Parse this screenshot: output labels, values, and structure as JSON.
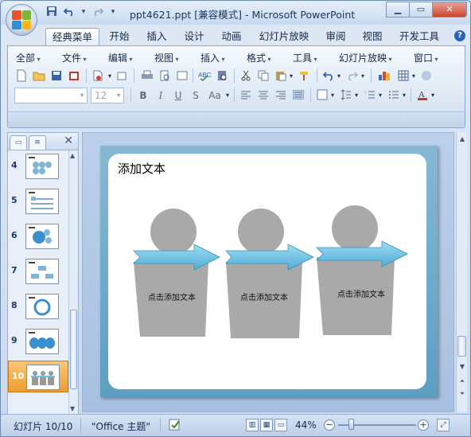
{
  "window": {
    "title": "ppt4621.ppt [兼容模式] - Microsoft PowerPoint",
    "minimize": "▁",
    "maximize": "▭",
    "close": "✕"
  },
  "qat": {
    "dropdown": "▾"
  },
  "tabs": [
    {
      "label": "经典菜单",
      "active": true
    },
    {
      "label": "开始"
    },
    {
      "label": "插入"
    },
    {
      "label": "设计"
    },
    {
      "label": "动画"
    },
    {
      "label": "幻灯片放映"
    },
    {
      "label": "审阅"
    },
    {
      "label": "视图"
    },
    {
      "label": "开发工具"
    }
  ],
  "help": "?",
  "menu": [
    "全部",
    "文件",
    "编辑",
    "视图",
    "插入",
    "格式",
    "工具",
    "幻灯片放映",
    "窗口"
  ],
  "format": {
    "font_name": "",
    "font_size": "12",
    "bold": "B",
    "italic": "I",
    "underline": "U",
    "strike": "S",
    "case": "Aa"
  },
  "left_panel": {
    "thumbnails": [
      {
        "number": "4"
      },
      {
        "number": "5"
      },
      {
        "number": "6"
      },
      {
        "number": "7"
      },
      {
        "number": "8"
      },
      {
        "number": "9"
      },
      {
        "number": "10",
        "selected": true
      }
    ]
  },
  "slide": {
    "title": "添加文本",
    "figures": [
      {
        "label": "点击添加文本"
      },
      {
        "label": "点击添加文本"
      },
      {
        "label": "点击添加文本"
      }
    ]
  },
  "status": {
    "slide_info": "幻灯片 10/10",
    "theme": "\"Office 主题\"",
    "zoom": "44%",
    "zoom_minus": "−",
    "zoom_plus": "+"
  },
  "colors": {
    "accent": "#2b61ba",
    "selected_thumb": "#ef9b2f",
    "slide_frame": "#5d9ec2",
    "figure_gray": "#a9a9a9",
    "arrow_blue": "#6cc3e6"
  }
}
